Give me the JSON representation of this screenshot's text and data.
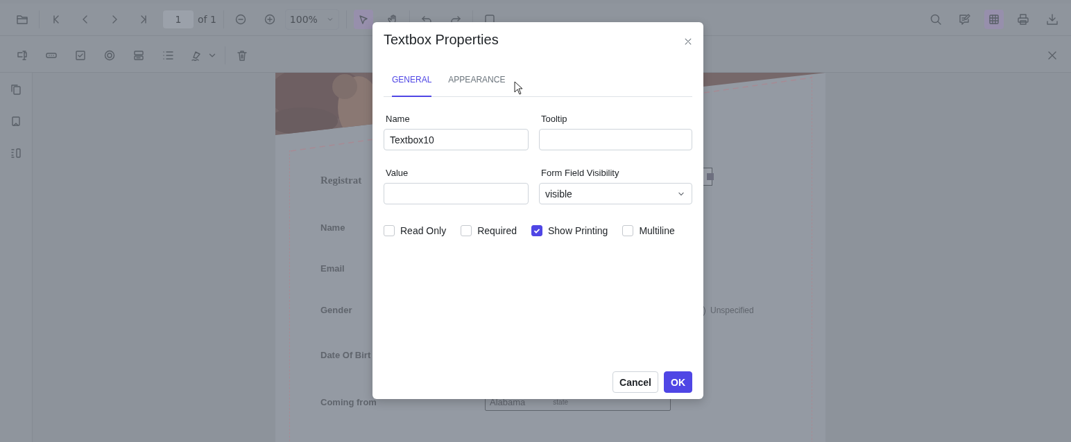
{
  "toolbar": {
    "page_input": "1",
    "page_count": "of 1",
    "zoom": "100%",
    "tools": [
      {
        "kind": "pointer",
        "selected": true
      },
      {
        "kind": "pan",
        "selected": false
      }
    ],
    "right_tools": [
      {
        "kind": "search",
        "selected": false
      },
      {
        "kind": "comment",
        "selected": false
      },
      {
        "kind": "grid",
        "selected": true
      },
      {
        "kind": "print",
        "selected": false
      },
      {
        "kind": "download",
        "selected": false
      }
    ]
  },
  "document": {
    "title": "Registrat",
    "fields": [
      {
        "label": "Name"
      },
      {
        "label": "Email"
      },
      {
        "label": "Gender"
      },
      {
        "label": "Date Of Birt"
      },
      {
        "label": "Coming from"
      }
    ],
    "radio_option": "Unspecified",
    "dropdown": {
      "value": "Alabama",
      "hint": "state"
    }
  },
  "dialog": {
    "title": "Textbox Properties",
    "tabs": [
      {
        "label": "GENERAL",
        "selected": true
      },
      {
        "label": "APPEARANCE",
        "selected": false
      }
    ],
    "fields": [
      {
        "label": "Name",
        "kind": "text",
        "value": "Textbox10"
      },
      {
        "label": "Tooltip",
        "kind": "text"
      },
      {
        "label": "Value",
        "kind": "text"
      },
      {
        "label": "Form Field Visibility",
        "kind": "dropdown",
        "value": "visible"
      }
    ],
    "checkboxes": [
      {
        "label": "Read Only",
        "checked": false
      },
      {
        "label": "Required",
        "checked": false
      },
      {
        "label": "Show Printing",
        "checked": true
      },
      {
        "label": "Multiline",
        "checked": false
      }
    ],
    "buttons": [
      {
        "label": "Cancel",
        "kind": "secondary"
      },
      {
        "label": "OK",
        "kind": "primary"
      }
    ]
  }
}
